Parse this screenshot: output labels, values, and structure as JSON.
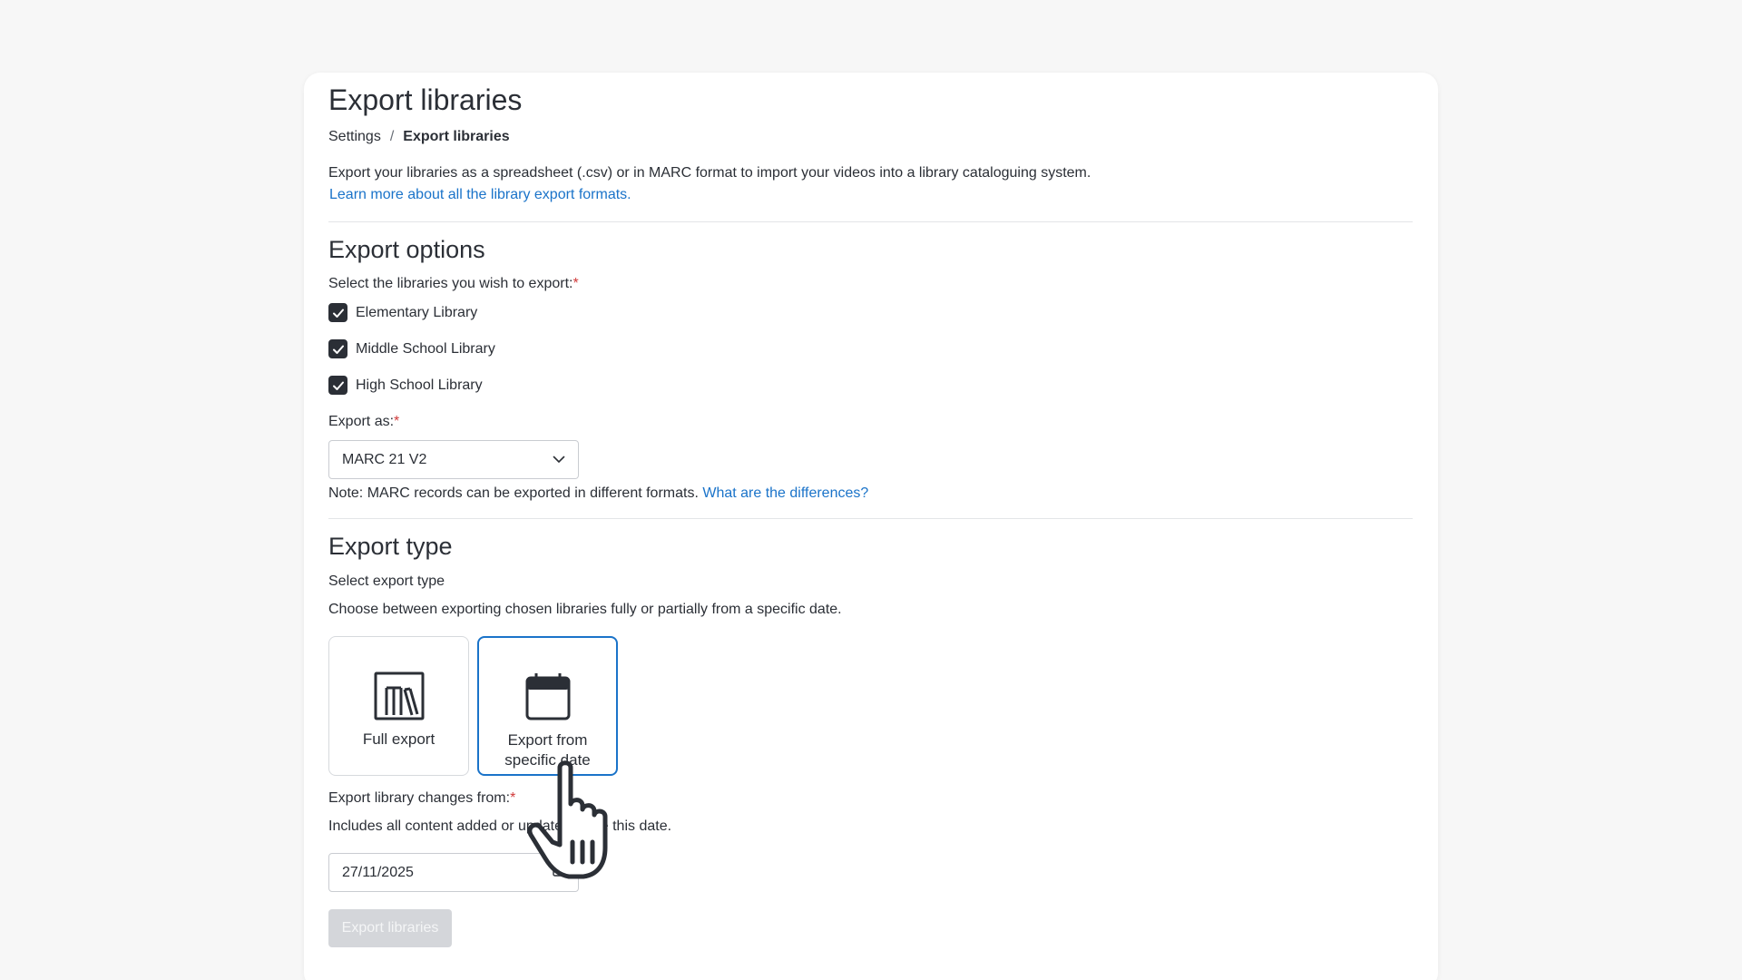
{
  "page": {
    "title": "Export libraries",
    "breadcrumb": {
      "parent": "Settings",
      "separator": "/",
      "current": "Export libraries"
    },
    "description": "Export your libraries as a spreadsheet (.csv) or in MARC format to import your videos into a library cataloguing system.",
    "learn_more_link": "Learn more about all the library export formats."
  },
  "export_options": {
    "heading": "Export options",
    "libraries_label": "Select the libraries you wish to export:",
    "required_mark": "*",
    "libraries": [
      {
        "label": "Elementary Library",
        "checked": true
      },
      {
        "label": "Middle School Library",
        "checked": true
      },
      {
        "label": "High School Library",
        "checked": true
      }
    ],
    "export_as_label": "Export as:",
    "export_as_value": "MARC 21 V2",
    "note_text": "Note: MARC records can be exported in different formats.",
    "note_link": "What are the differences?"
  },
  "export_type": {
    "heading": "Export type",
    "select_label": "Select export type",
    "description": "Choose between exporting chosen libraries fully or partially from a specific date.",
    "options": [
      {
        "label": "Full export",
        "icon": "library-icon",
        "selected": false
      },
      {
        "label": "Export from specific date",
        "icon": "calendar-icon",
        "selected": true
      }
    ],
    "changes_from_label": "Export library changes from:",
    "changes_from_help": "Includes all content added or updated since this date.",
    "date_value": "27/11/2025"
  },
  "submit_button": "Export libraries",
  "colors": {
    "accent": "#1a73c9",
    "required": "#d03a3a",
    "disabled_button": "#d4d6da",
    "text": "#2b2f36"
  }
}
